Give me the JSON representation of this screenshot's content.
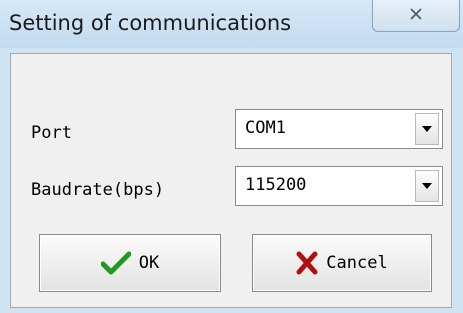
{
  "window": {
    "title": "Setting of communications",
    "close_icon": "close-icon"
  },
  "form": {
    "port": {
      "label": "Port",
      "value": "COM1"
    },
    "baudrate": {
      "label": "Baudrate(bps)",
      "value": "115200"
    }
  },
  "buttons": {
    "ok": {
      "label": "OK",
      "icon": "checkmark-icon",
      "icon_color": "#1e9a1e"
    },
    "cancel": {
      "label": "Cancel",
      "icon": "x-mark-icon",
      "icon_color": "#b01010"
    }
  },
  "colors": {
    "title_bar": "#c9dff1",
    "client_bg": "#f0f0f0"
  }
}
